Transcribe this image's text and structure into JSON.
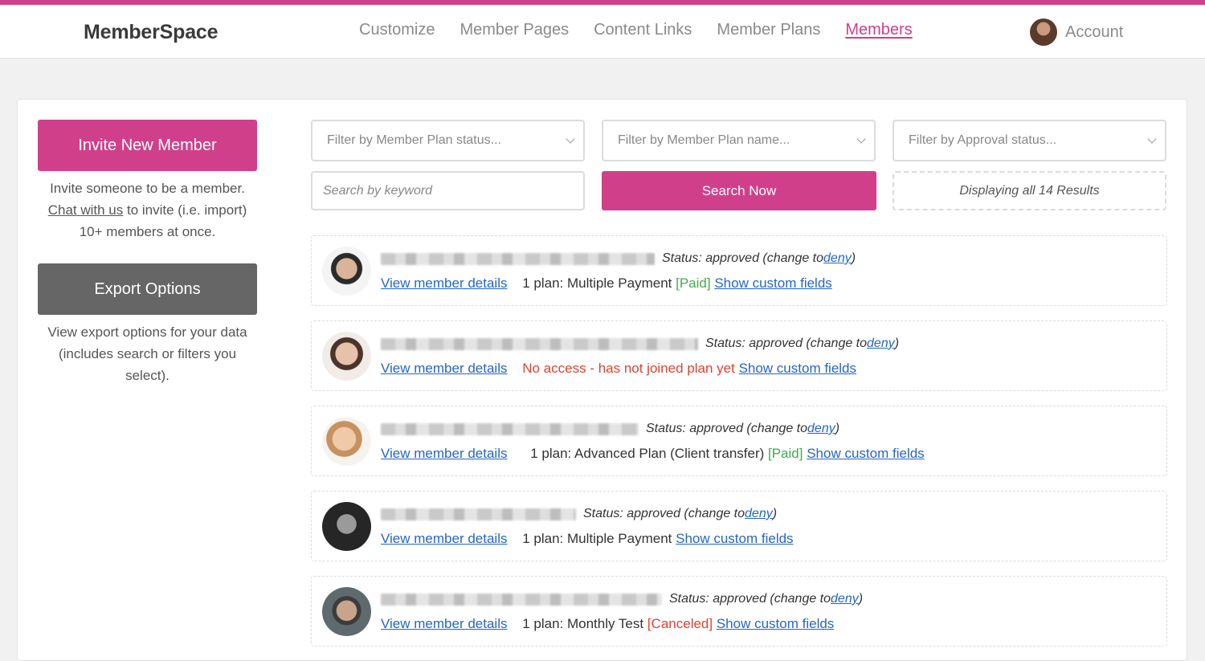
{
  "header": {
    "logo": "MemberSpace",
    "nav": [
      "Customize",
      "Member Pages",
      "Content Links",
      "Member Plans",
      "Members"
    ],
    "account_label": "Account"
  },
  "sidebar": {
    "invite_label": "Invite New Member",
    "invite_text1": "Invite someone to be a member.",
    "chat_link": "Chat with us",
    "invite_text2": " to invite (i.e. import) 10+ members at once.",
    "export_label": "Export Options",
    "export_text": "View export options for your data (includes search or filters you select)."
  },
  "filters": {
    "plan_status_placeholder": "Filter by Member Plan status...",
    "plan_name_placeholder": "Filter by Member Plan name...",
    "approval_placeholder": "Filter by Approval status...",
    "search_placeholder": "Search by keyword",
    "search_button": "Search Now",
    "results_text": "Displaying all 14 Results"
  },
  "members": [
    {
      "status_text": "Status: approved (change to ",
      "deny": "deny",
      "close": ")",
      "details": "View member details",
      "plan_text": "1 plan: Multiple Payment ",
      "tag": "[Paid]",
      "custom": "Show custom fields"
    },
    {
      "status_text": "Status: approved (change to ",
      "deny": "deny",
      "close": ")",
      "details": "View member details",
      "plan_text": "No access - has not joined plan yet",
      "tag": "",
      "custom": "Show custom fields"
    },
    {
      "status_text": "Status: approved (change to ",
      "deny": "deny",
      "close": ")",
      "details": "View member details",
      "plan_text": "1 plan: Advanced Plan (Client transfer) ",
      "tag": "[Paid]",
      "custom": "Show custom fields"
    },
    {
      "status_text": "Status: approved (change to ",
      "deny": "deny",
      "close": ")",
      "details": "View member details",
      "plan_text": "1 plan: Multiple Payment",
      "tag": "",
      "custom": "Show custom fields"
    },
    {
      "status_text": "Status: approved (change to ",
      "deny": "deny",
      "close": ")",
      "details": "View member details",
      "plan_text": "1 plan: Monthly Test ",
      "tag": "[Canceled]",
      "custom": "Show custom fields"
    }
  ],
  "colors": {
    "accent": "#d0408a",
    "link": "#2566c8",
    "paid": "#3fae49",
    "alert": "#e0422f"
  }
}
